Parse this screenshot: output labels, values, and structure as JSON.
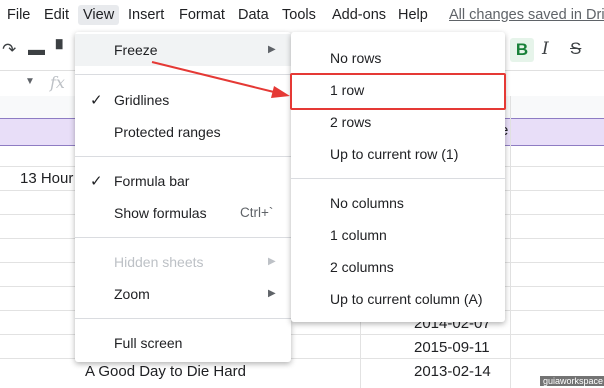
{
  "menubar": {
    "items": [
      "File",
      "Edit",
      "View",
      "Insert",
      "Format",
      "Data",
      "Tools",
      "Add-ons",
      "Help"
    ],
    "saved_status": "All changes saved in Drive"
  },
  "formula": {
    "fx": "fx"
  },
  "toolbar": {
    "bold": "B",
    "italic": "I",
    "strike": "S"
  },
  "sheet": {
    "header_partial": "e",
    "cells": [
      {
        "text": "13 Hour"
      },
      {
        "text": "2014-02-07"
      },
      {
        "text": "2015-09-11"
      },
      {
        "text": "A Good Day to Die Hard"
      },
      {
        "text": "2013-02-14"
      }
    ]
  },
  "view_menu": {
    "items": [
      {
        "label": "Freeze",
        "submenu": true,
        "highlighted": true
      },
      {
        "label": "Gridlines",
        "checked": true
      },
      {
        "label": "Protected ranges"
      },
      {
        "label": "Formula bar",
        "checked": true
      },
      {
        "label": "Show formulas",
        "shortcut": "Ctrl+`"
      },
      {
        "label": "Hidden sheets",
        "submenu": true,
        "disabled": true
      },
      {
        "label": "Zoom",
        "submenu": true
      },
      {
        "label": "Full screen"
      }
    ]
  },
  "freeze_submenu": {
    "items": [
      "No rows",
      "1 row",
      "2 rows",
      "Up to current row (1)",
      "No columns",
      "1 column",
      "2 columns",
      "Up to current column (A)"
    ]
  },
  "annotation_color": "#e53935",
  "watermark": "guiaworkspace"
}
